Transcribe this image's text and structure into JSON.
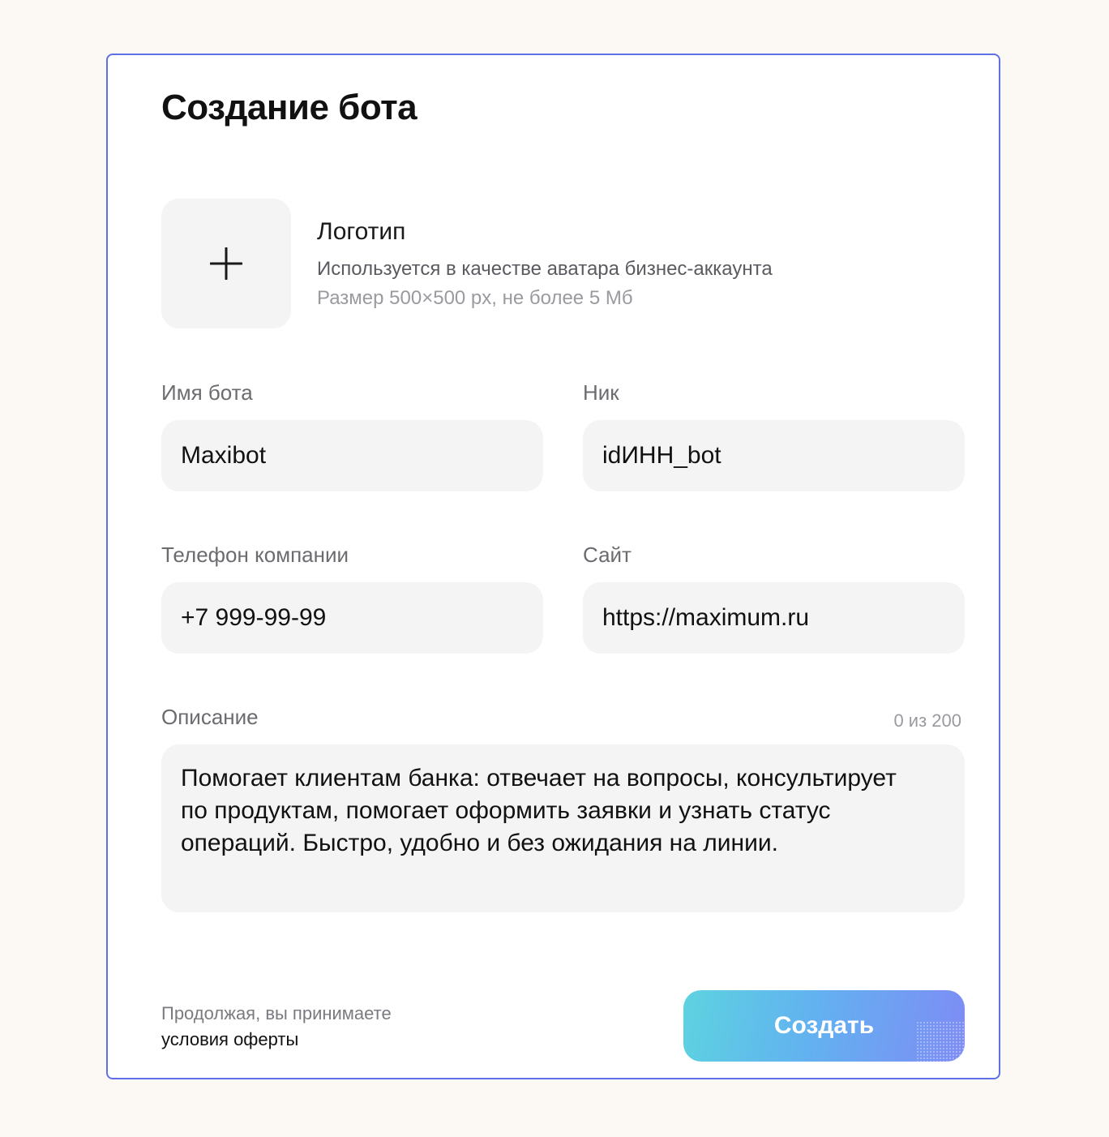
{
  "form": {
    "title": "Создание бота",
    "logo": {
      "title": "Логотип",
      "description": "Используется в качестве аватара бизнес-аккаунта",
      "size_hint": "Размер 500×500 px, не более 5 Мб",
      "upload_icon": "plus-icon"
    },
    "fields": {
      "bot_name": {
        "label": "Имя бота",
        "value": "Maxibot"
      },
      "nick": {
        "label": "Ник",
        "value": "idИНН_bot"
      },
      "phone": {
        "label": "Телефон компании",
        "value": "+7 999-99-99"
      },
      "site": {
        "label": "Сайт",
        "value": "https://maximum.ru"
      },
      "description": {
        "label": "Описание",
        "counter": "0 из 200",
        "value": "Помогает клиентам банка: отвечает на вопросы, консультирует по продуктам, помогает оформить заявки и узнать статус операций. Быстро, удобно и без ожидания на линии."
      }
    },
    "terms": {
      "text": "Продолжая, вы принимаете",
      "link": "условия оферты"
    },
    "submit_label": "Создать"
  },
  "colors": {
    "page_background": "#fcf9f5",
    "card_border": "#5f6fe8",
    "field_background": "#f4f4f5",
    "button_gradient_start": "#5dd3e0",
    "button_gradient_end": "#7e8cf5"
  }
}
